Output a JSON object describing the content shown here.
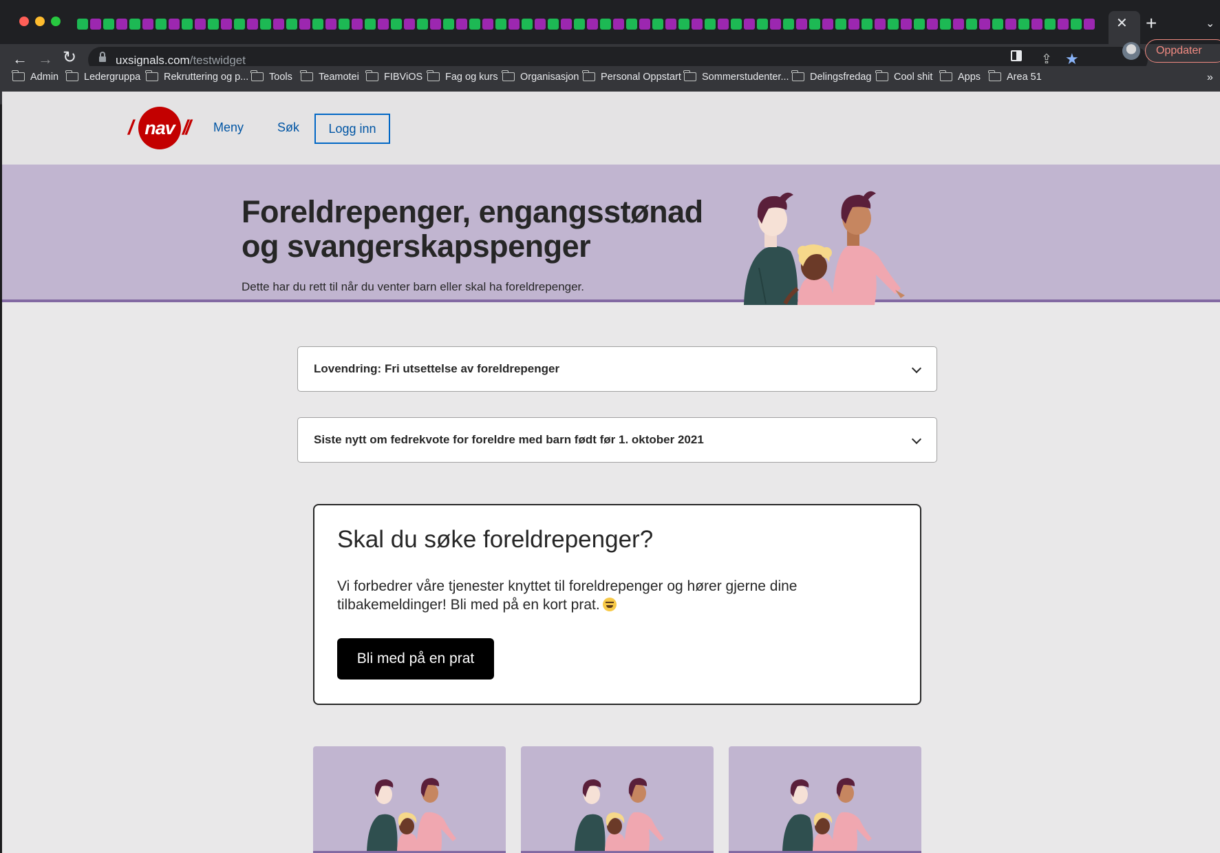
{
  "browser": {
    "url_host": "uxsignals.com",
    "url_path": "/testwidget",
    "update_button": "Oppdater",
    "bookmarks": [
      {
        "label": "Admin"
      },
      {
        "label": "Ledergruppa"
      },
      {
        "label": "Rekruttering og p..."
      },
      {
        "label": "Tools"
      },
      {
        "label": "Teamotei"
      },
      {
        "label": "FIBViOS"
      },
      {
        "label": "Fag og kurs"
      },
      {
        "label": "Organisasjon"
      },
      {
        "label": "Personal Oppstart"
      },
      {
        "label": "Sommerstudenter..."
      },
      {
        "label": "Delingsfredag"
      },
      {
        "label": "Cool shit"
      },
      {
        "label": "Apps"
      },
      {
        "label": "Area 51"
      }
    ],
    "icons": [
      "back-arrow-icon",
      "forward-arrow-icon",
      "reload-icon",
      "lock-icon",
      "share-icon",
      "star-icon",
      "side-panel-icon",
      "profile-avatar",
      "folder-icon",
      "close-icon",
      "plus-icon"
    ]
  },
  "site": {
    "logo_text": "nav",
    "nav": {
      "menu": "Meny",
      "search": "Søk",
      "login": "Logg inn"
    },
    "hero": {
      "title": "Foreldrepenger, engangsstønad og svangerskapspenger",
      "subtitle": "Dette har du rett til når du venter barn eller skal ha foreldrepenger."
    },
    "accordions": [
      {
        "label": "Lovendring: Fri utsettelse av foreldrepenger"
      },
      {
        "label": "Siste nytt om fedrekvote for foreldre med barn født før 1. oktober 2021"
      }
    ],
    "survey": {
      "title": "Skal du søke foreldrepenger?",
      "text": "Vi forbedrer våre tjenester knyttet til foreldrepenger og hører gjerne dine tilbakemeldinger! Bli med på en kort prat.",
      "button": "Bli med på en prat"
    },
    "colors": {
      "brand_red": "#c30000",
      "link_blue": "#0055a4",
      "hero_lilac": "#c1b5d0",
      "hero_border": "#8269a2"
    }
  }
}
